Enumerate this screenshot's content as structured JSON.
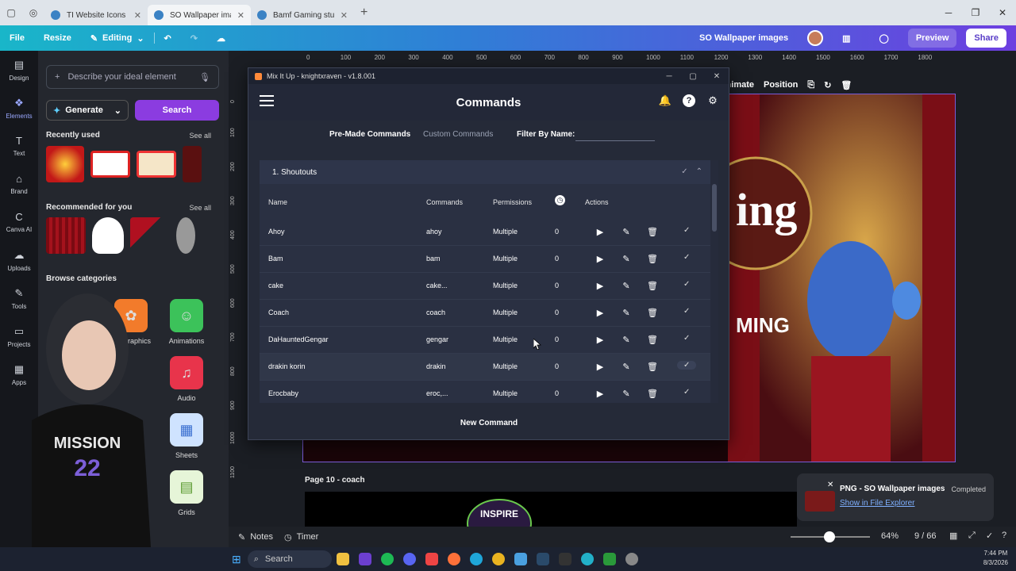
{
  "browser": {
    "tabs": [
      {
        "label": "TI Website Icons - ...",
        "active": false
      },
      {
        "label": "SO Wallpaper imag...",
        "active": true
      },
      {
        "label": "Bamf Gaming stuff ...",
        "active": false
      }
    ]
  },
  "canva": {
    "file_label": "File",
    "resize_label": "Resize",
    "editing_label": "Editing",
    "doc_title": "SO Wallpaper images",
    "preview_label": "Preview",
    "share_label": "Share",
    "rail": [
      {
        "label": "Design",
        "icon": "layout-icon"
      },
      {
        "label": "Elements",
        "icon": "elements-icon"
      },
      {
        "label": "Text",
        "icon": "text-icon"
      },
      {
        "label": "Brand",
        "icon": "brand-icon"
      },
      {
        "label": "Canva AI",
        "icon": "ai-icon"
      },
      {
        "label": "Uploads",
        "icon": "uploads-icon"
      },
      {
        "label": "Tools",
        "icon": "tools-icon"
      },
      {
        "label": "Projects",
        "icon": "projects-icon"
      },
      {
        "label": "Apps",
        "icon": "apps-icon"
      }
    ],
    "panel": {
      "search_placeholder": "Describe your ideal element",
      "generate_label": "Generate",
      "search_label": "Search",
      "recently_used": "Recently used",
      "recommended": "Recommended for you",
      "see_all": "See all",
      "browse_categories": "Browse categories",
      "categories": [
        "Graphics",
        "Animations",
        "Audio",
        "Sheets",
        "Grids"
      ]
    },
    "ruler_x": [
      "0",
      "100",
      "200",
      "300",
      "400",
      "500",
      "600",
      "700",
      "800",
      "900",
      "1000",
      "1100",
      "1200",
      "1300",
      "1400",
      "1500",
      "1600",
      "1700",
      "1800"
    ],
    "ruler_y": [
      "0",
      "100",
      "200",
      "300",
      "400",
      "500",
      "600",
      "700",
      "800",
      "900",
      "1000",
      "1100"
    ],
    "animate_label": "Animate",
    "position_label": "Position",
    "page_label": "Page 10 - coach",
    "notes_label": "Notes",
    "timer_label": "Timer",
    "zoom": "64%",
    "pages": "9 / 66",
    "toast": {
      "title": "PNG - SO Wallpaper images",
      "status": "Completed",
      "link": "Show in File Explorer"
    }
  },
  "mixitup": {
    "window_title": "Mix It Up - knightxraven - v1.8.001",
    "header_title": "Commands",
    "tabs": [
      "Pre-Made Commands",
      "Custom Commands"
    ],
    "filter_label": "Filter By Name:",
    "filter_value": "",
    "group_title": "1. Shoutouts",
    "columns": {
      "name": "Name",
      "commands": "Commands",
      "permissions": "Permissions",
      "actions": "Actions"
    },
    "rows": [
      {
        "name": "Ahoy",
        "command": "ahoy",
        "permission": "Multiple",
        "count": "0"
      },
      {
        "name": "Bam",
        "command": "bam",
        "permission": "Multiple",
        "count": "0"
      },
      {
        "name": "cake",
        "command": "cake...",
        "permission": "Multiple",
        "count": "0"
      },
      {
        "name": "Coach",
        "command": "coach",
        "permission": "Multiple",
        "count": "0"
      },
      {
        "name": "DaHauntedGengar",
        "command": "gengar",
        "permission": "Multiple",
        "count": "0"
      },
      {
        "name": "drakin korin",
        "command": "drakin",
        "permission": "Multiple",
        "count": "0"
      },
      {
        "name": "Erocbaby",
        "command": "eroc,...",
        "permission": "Multiple",
        "count": "0"
      }
    ],
    "new_command_label": "New Command"
  },
  "taskbar": {
    "search_label": "Search",
    "time": "7:44 PM",
    "date": "8/3/2026"
  }
}
